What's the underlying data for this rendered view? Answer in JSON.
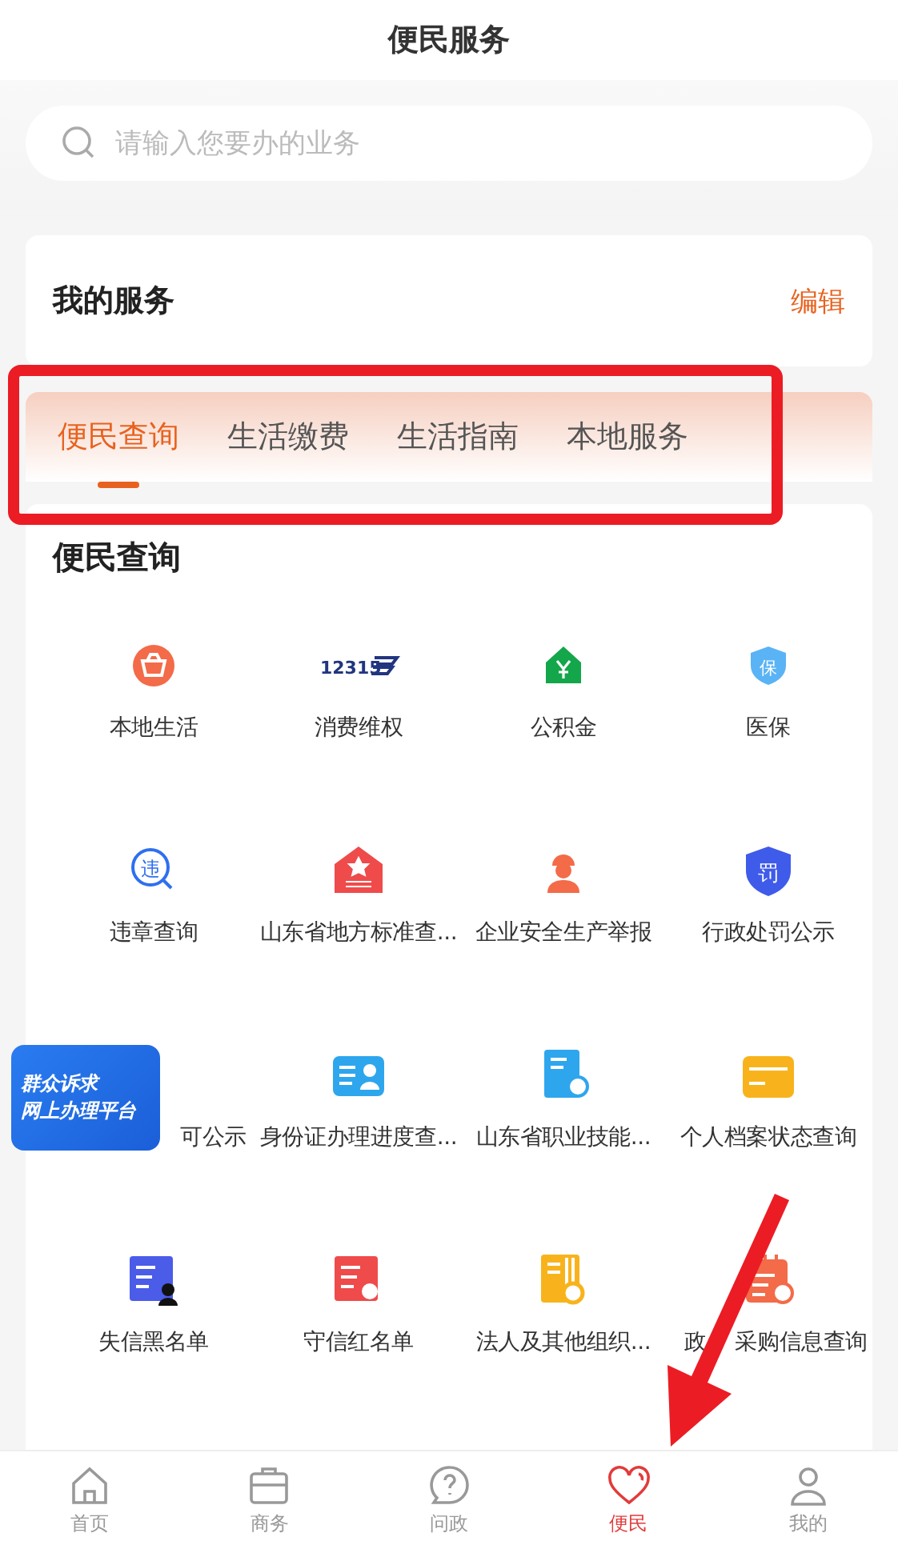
{
  "header": {
    "title": "便民服务"
  },
  "search": {
    "placeholder": "请输入您要办的业务"
  },
  "my_services": {
    "title": "我的服务",
    "action": "编辑"
  },
  "tabs": [
    {
      "label": "便民查询",
      "selected": true
    },
    {
      "label": "生活缴费",
      "selected": false
    },
    {
      "label": "生活指南",
      "selected": false
    },
    {
      "label": "本地服务",
      "selected": false
    }
  ],
  "section": {
    "title": "便民查询",
    "items": [
      {
        "label": "本地生活"
      },
      {
        "label": "消费维权",
        "icon_text": "12315"
      },
      {
        "label": "公积金"
      },
      {
        "label": "医保",
        "icon_text": "保"
      },
      {
        "label": "违章查询",
        "icon_text": "违"
      },
      {
        "label": "山东省地方标准查..."
      },
      {
        "label": "企业安全生产举报"
      },
      {
        "label": "行政处罚公示",
        "icon_text": "罚"
      },
      {
        "label": "可公示",
        "kind": "covered"
      },
      {
        "label": "身份证办理进度查..."
      },
      {
        "label": "山东省职业技能..."
      },
      {
        "label": "个人档案状态查询"
      },
      {
        "label": "失信黑名单"
      },
      {
        "label": "守信红名单"
      },
      {
        "label": "法人及其他组织..."
      },
      {
        "label": "政",
        "kind": "split",
        "label_end": "采购信息查询"
      }
    ]
  },
  "floating_badge": {
    "lines": [
      "群众诉求",
      "网上办理平台"
    ]
  },
  "bottom_nav": [
    {
      "label": "首页",
      "selected": false
    },
    {
      "label": "商务",
      "selected": false
    },
    {
      "label": "问政",
      "selected": false
    },
    {
      "label": "便民",
      "selected": true
    },
    {
      "label": "我的",
      "selected": false
    }
  ]
}
